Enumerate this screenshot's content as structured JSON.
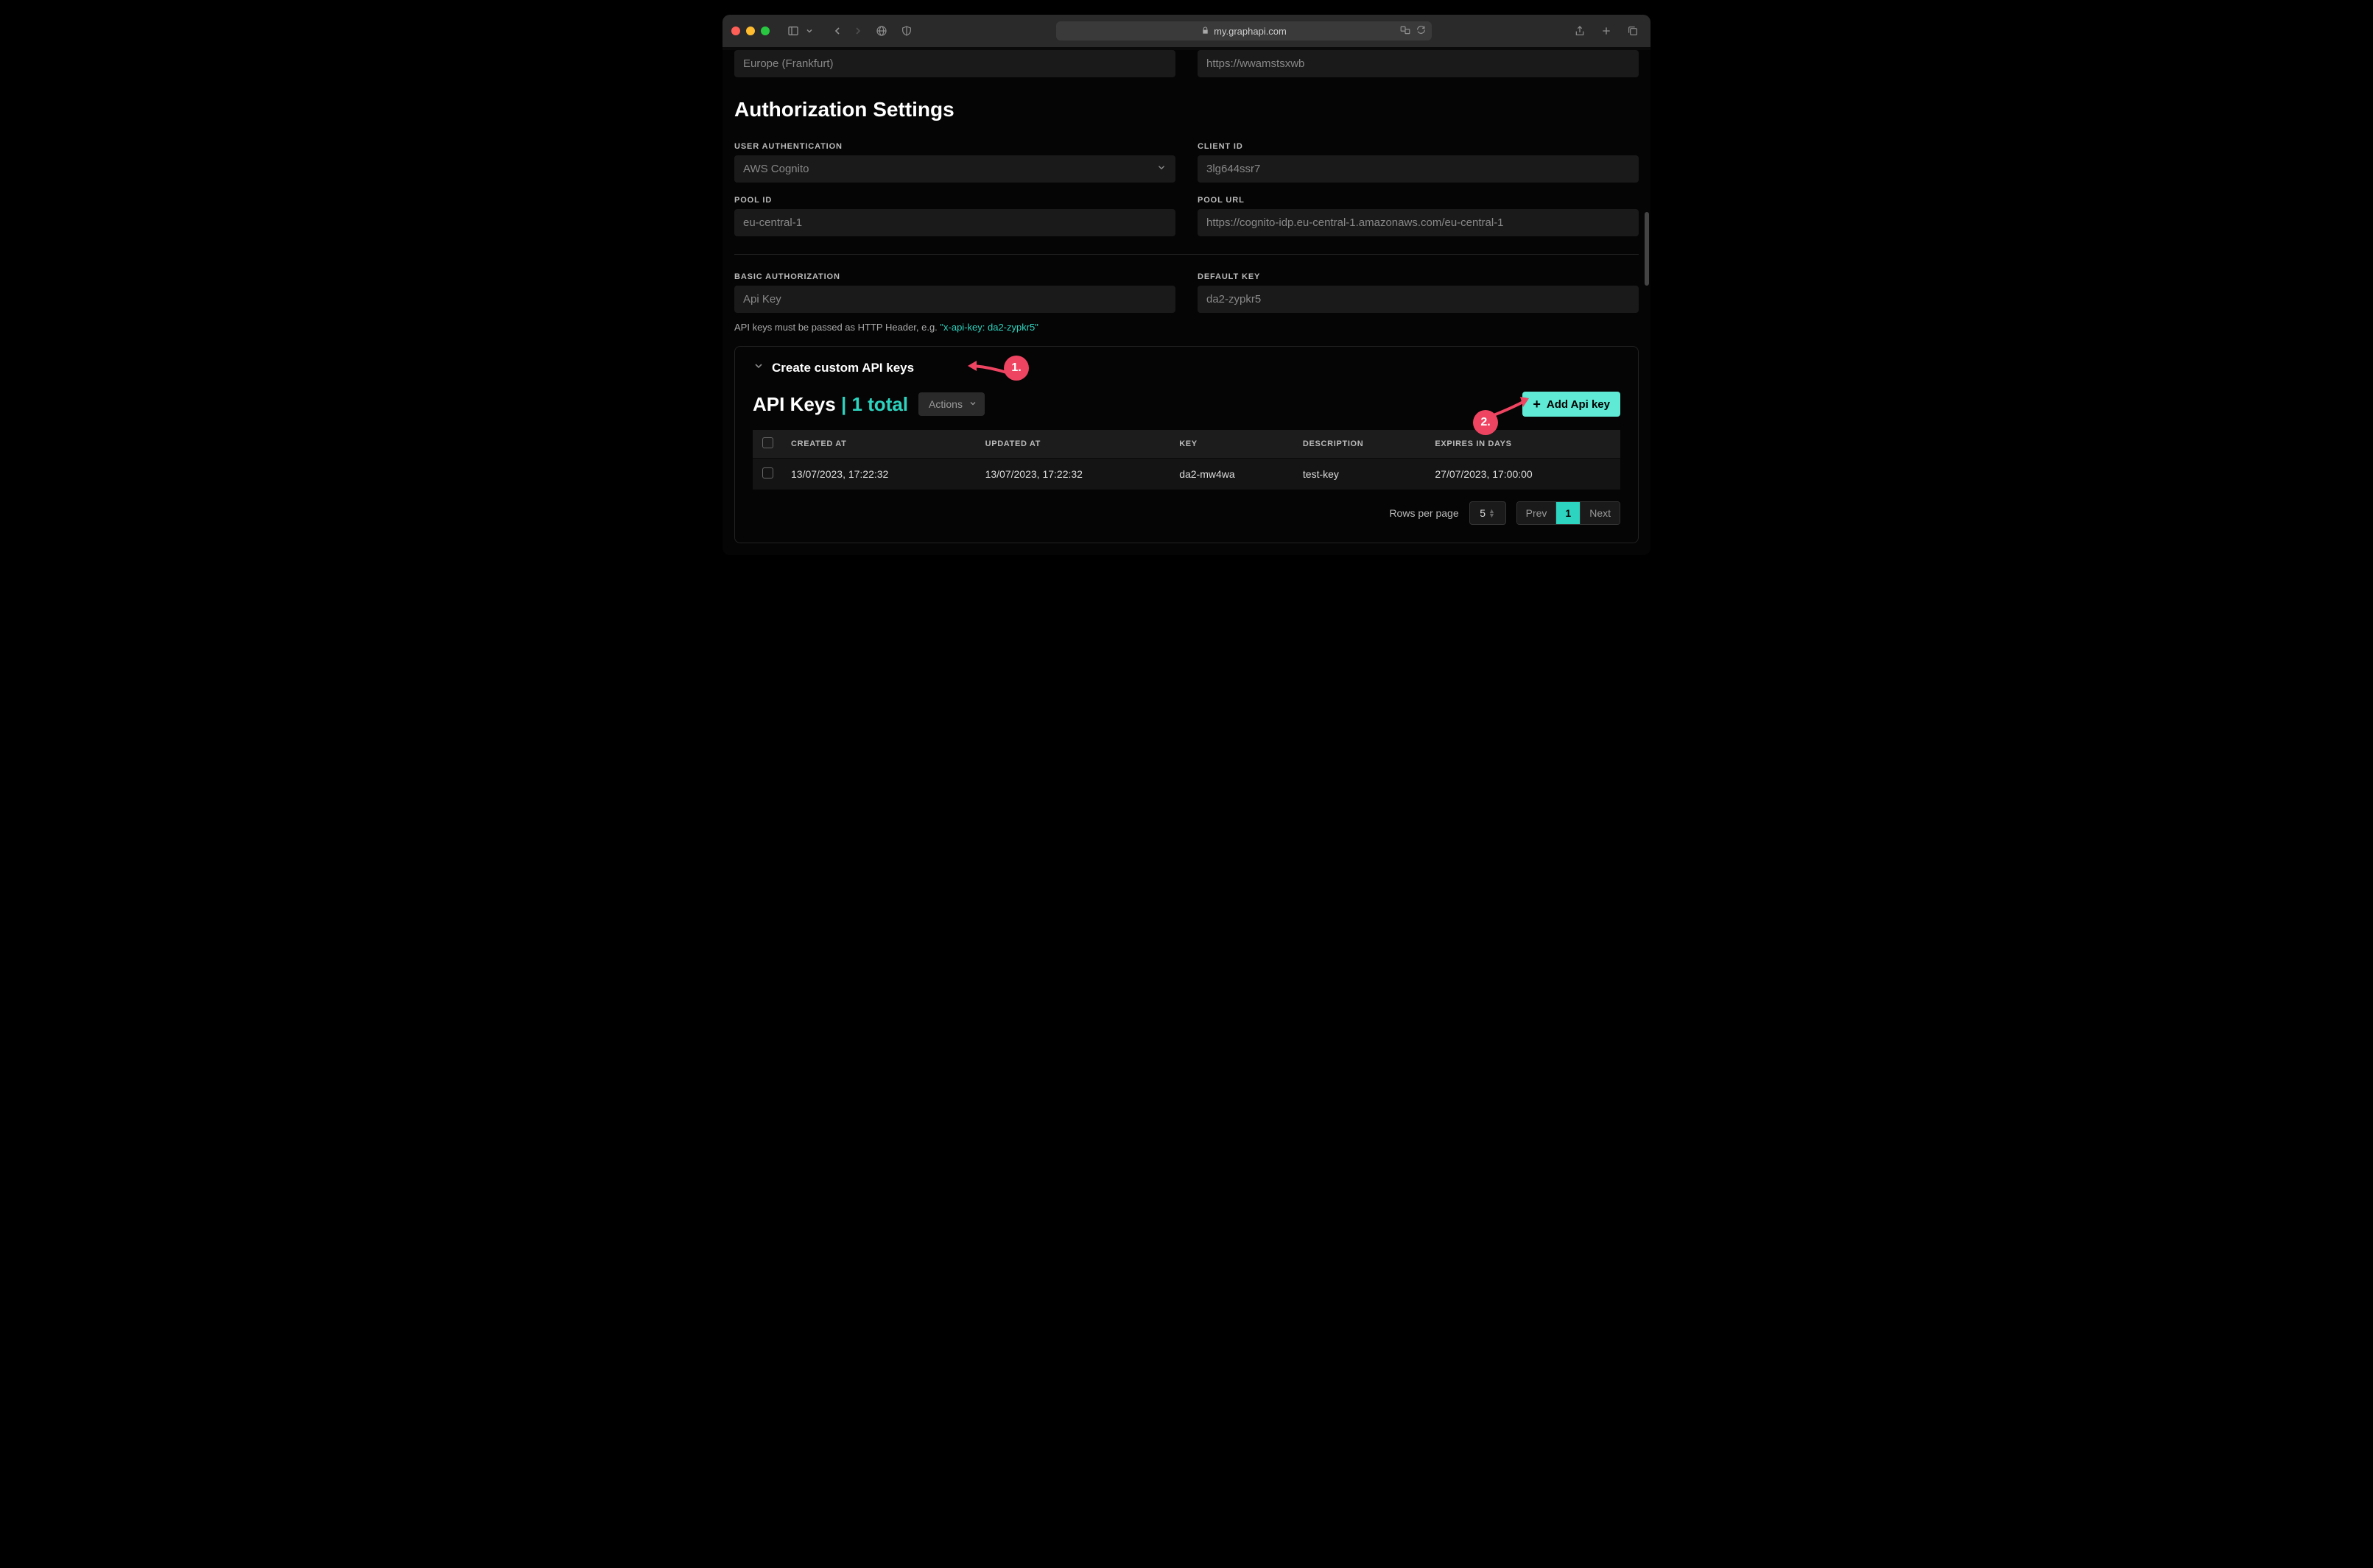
{
  "browser": {
    "url": "my.graphapi.com"
  },
  "top_fields": {
    "region": {
      "value": "Europe (Frankfurt)"
    },
    "endpoint": {
      "value": "https://wwamstsxwb"
    }
  },
  "section_title": "Authorization Settings",
  "auth": {
    "user_auth": {
      "label": "USER AUTHENTICATION",
      "value": "AWS Cognito"
    },
    "client_id": {
      "label": "CLIENT ID",
      "value": "3lg644ssr7"
    },
    "pool_id": {
      "label": "POOL ID",
      "value": "eu-central-1"
    },
    "pool_url": {
      "label": "POOL URL",
      "value": "https://cognito-idp.eu-central-1.amazonaws.com/eu-central-1"
    }
  },
  "basic": {
    "basic_auth": {
      "label": "BASIC AUTHORIZATION",
      "value": "Api Key"
    },
    "default_key": {
      "label": "DEFAULT KEY",
      "value": "da2-zypkr5"
    },
    "help_prefix": "API keys must be passed as HTTP Header, e.g. ",
    "help_code": "\"x-api-key: da2-zypkr5\""
  },
  "panel": {
    "title": "Create custom API keys",
    "keys_title": "API Keys",
    "keys_count": "1 total",
    "actions_label": "Actions",
    "add_label": "Add Api key",
    "columns": {
      "created": "CREATED AT",
      "updated": "UPDATED AT",
      "key": "KEY",
      "description": "DESCRIPTION",
      "expires": "EXPIRES IN DAYS"
    },
    "rows": [
      {
        "created": "13/07/2023, 17:22:32",
        "updated": "13/07/2023, 17:22:32",
        "key": "da2-mw4wa",
        "description": "test-key",
        "expires": "27/07/2023, 17:00:00"
      }
    ],
    "pagination": {
      "rows_label": "Rows per page",
      "rows_value": "5",
      "prev": "Prev",
      "page": "1",
      "next": "Next"
    }
  },
  "annotations": {
    "a1": "1.",
    "a2": "2."
  }
}
